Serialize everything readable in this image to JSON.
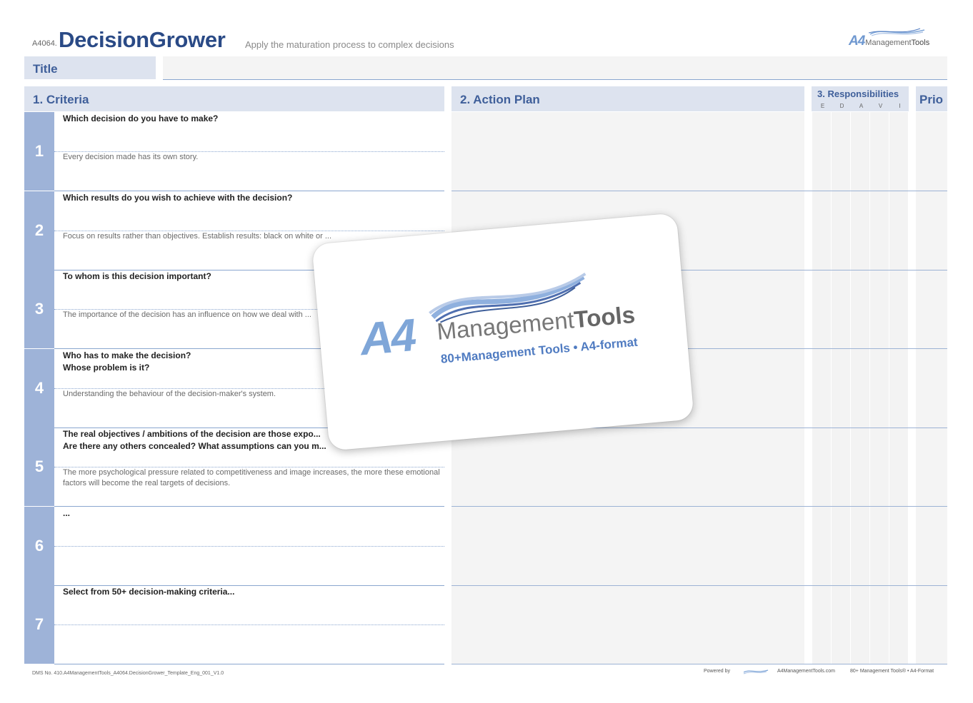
{
  "header": {
    "code": "A4064.",
    "title": "DecisionGrower",
    "subtitle": "Apply the maturation process to complex decisions",
    "logo_a4": "A4",
    "logo_management": "Management",
    "logo_tools": "Tools"
  },
  "title_row": {
    "label": "Title",
    "value": ""
  },
  "sections": {
    "criteria": "1. Criteria",
    "action_plan": "2. Action Plan",
    "responsibilities": "3. Responsibilities",
    "prio": "Prio"
  },
  "raci_letters": [
    "E",
    "D",
    "A",
    "V",
    "I"
  ],
  "criteria": [
    {
      "number": "1",
      "question": "Which decision do you have to make?",
      "hint": "Every decision made has its own story."
    },
    {
      "number": "2",
      "question": "Which results do you wish to achieve with the decision?",
      "hint": "Focus on results rather than objectives. Establish results: black on white or ..."
    },
    {
      "number": "3",
      "question": "To whom is this decision important?",
      "hint": "The importance of the decision has an influence on how we deal with ..."
    },
    {
      "number": "4",
      "question": "Who has to make the decision?\nWhose problem is it?",
      "hint": "Understanding the behaviour of the decision-maker's system."
    },
    {
      "number": "5",
      "question": "The real objectives / ambitions of the decision are those expo...\nAre there any others concealed? What assumptions can you m...",
      "hint": "The more psychological pressure related to competitiveness and image increases, the more these emotional factors will become the real targets of decisions."
    },
    {
      "number": "6",
      "question": "...",
      "hint": ""
    },
    {
      "number": "7",
      "question": "Select from 50+ decision-making criteria...",
      "hint": ""
    }
  ],
  "overlay_card": {
    "a4": "A4",
    "management": "Management",
    "tools": "Tools",
    "tagline": "80+Management Tools • A4-format"
  },
  "footer": {
    "dms": "DMS No. 410.A4ManagementTools_A4064.DecisionGrower_Template_Eng_001_V1.0",
    "powered_by": "Powered by",
    "site": "A4ManagementTools.com",
    "tagline": "80+ Management Tools® • A4-Format"
  },
  "colors": {
    "accent": "#2a4a86",
    "section_bg": "#dde3ef",
    "number_bg": "#9eb3d8",
    "grid": "#8aa6cf"
  }
}
